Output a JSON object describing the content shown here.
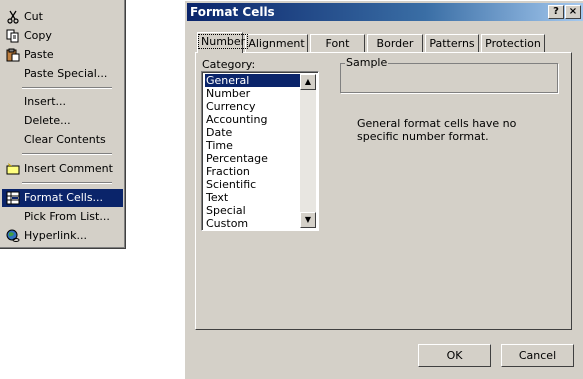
{
  "context_menu": {
    "items": [
      {
        "label": "Cut",
        "icon": "scissors-icon"
      },
      {
        "label": "Copy",
        "icon": "copy-icon"
      },
      {
        "label": "Paste",
        "icon": "paste-icon"
      },
      {
        "label": "Paste Special...",
        "icon": ""
      },
      {
        "label": "Insert...",
        "icon": ""
      },
      {
        "label": "Delete...",
        "icon": ""
      },
      {
        "label": "Clear Contents",
        "icon": ""
      },
      {
        "label": "Insert Comment",
        "icon": "comment-icon"
      },
      {
        "label": "Format Cells...",
        "icon": "format-cells-icon",
        "selected": true
      },
      {
        "label": "Pick From List...",
        "icon": ""
      },
      {
        "label": "Hyperlink...",
        "icon": "hyperlink-icon"
      }
    ]
  },
  "dialog": {
    "title": "Format Cells",
    "help_button": "?",
    "close_button": "×",
    "tabs": [
      "Number",
      "Alignment",
      "Font",
      "Border",
      "Patterns",
      "Protection"
    ],
    "active_tab": "Number",
    "category_label": "Category:",
    "categories": [
      "General",
      "Number",
      "Currency",
      "Accounting",
      "Date",
      "Time",
      "Percentage",
      "Fraction",
      "Scientific",
      "Text",
      "Special",
      "Custom"
    ],
    "selected_category": "General",
    "sample_label": "Sample",
    "description": "General format cells have no specific number format.",
    "ok_label": "OK",
    "cancel_label": "Cancel"
  },
  "colors": {
    "face": "#d4d0c8",
    "highlight": "#0a246a",
    "title_gradient_end": "#a6caf0"
  }
}
